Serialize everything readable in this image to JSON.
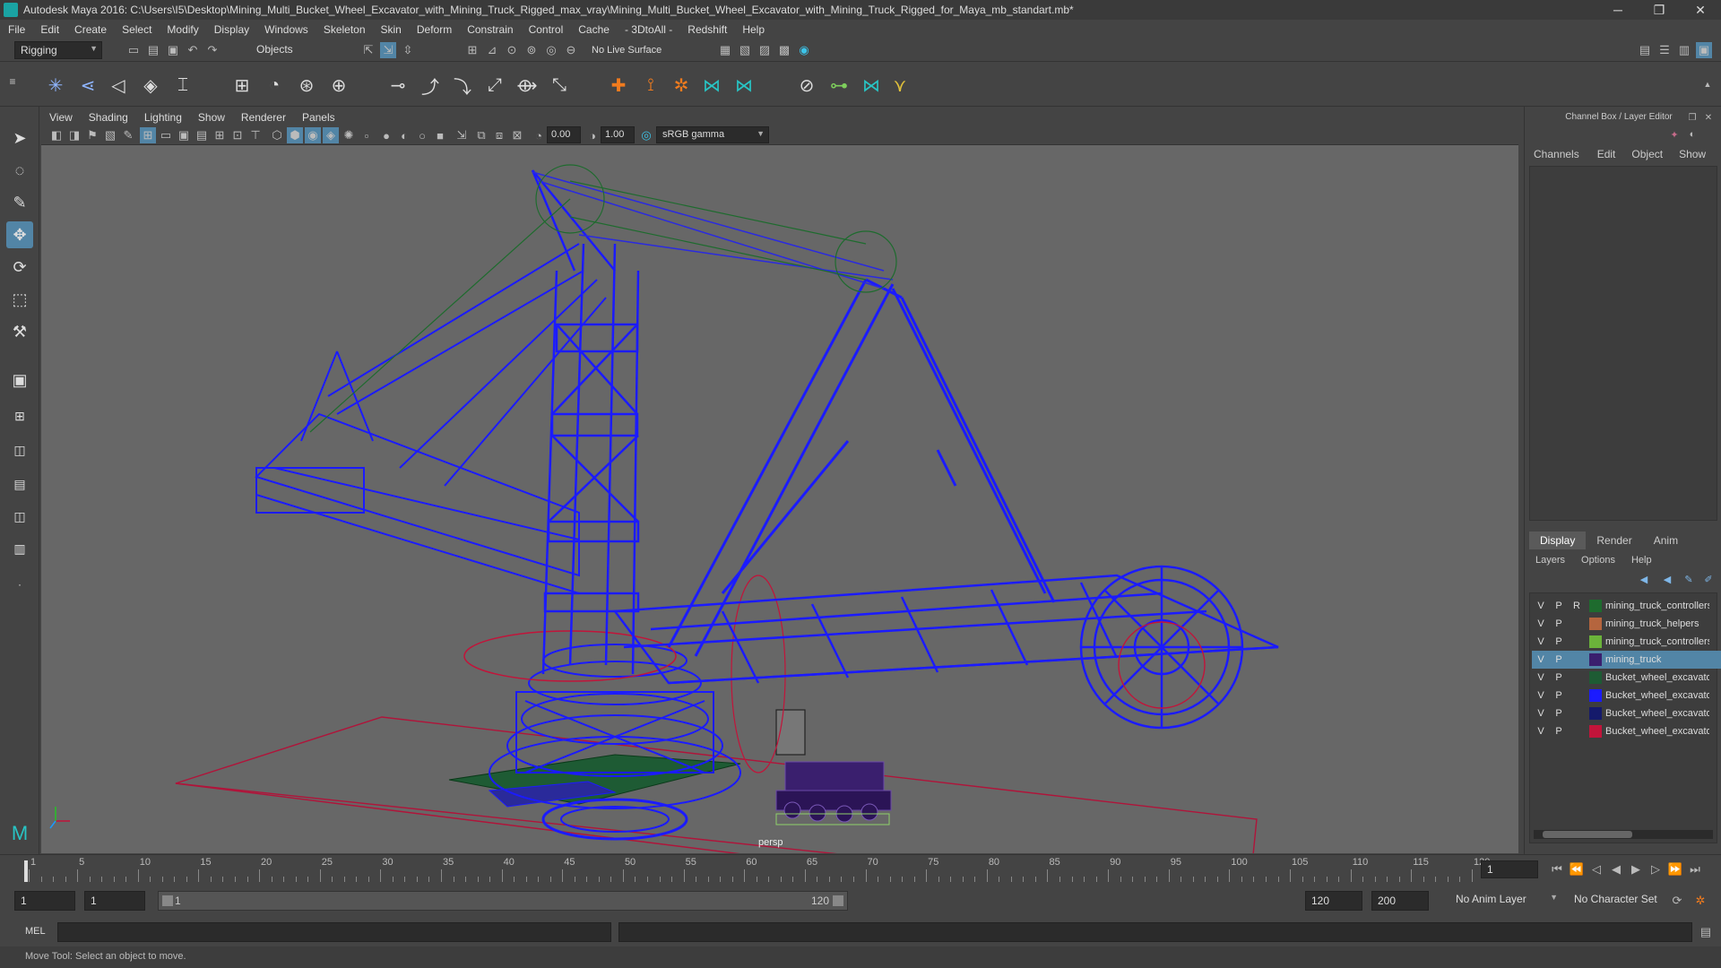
{
  "window": {
    "title": "Autodesk Maya 2016: C:\\Users\\I5\\Desktop\\Mining_Multi_Bucket_Wheel_Excavator_with_Mining_Truck_Rigged_max_vray\\Mining_Multi_Bucket_Wheel_Excavator_with_Mining_Truck_Rigged_for_Maya_mb_standart.mb*",
    "minimize": "─",
    "restore": "❐",
    "close": "✕"
  },
  "menubar": [
    "File",
    "Edit",
    "Create",
    "Select",
    "Modify",
    "Display",
    "Windows",
    "Skeleton",
    "Skin",
    "Deform",
    "Constrain",
    "Control",
    "Cache",
    "- 3DtoAll -",
    "Redshift",
    "Help"
  ],
  "statusline": {
    "menuset": "Rigging",
    "selection_mode": "Objects",
    "live_surface": "No Live Surface"
  },
  "panel_menu": [
    "View",
    "Shading",
    "Lighting",
    "Show",
    "Renderer",
    "Panels"
  ],
  "panel_tools": {
    "near_value": "0.00",
    "far_value": "1.00",
    "color_space": "sRGB gamma"
  },
  "viewport": {
    "camera_label": "persp"
  },
  "channel_box": {
    "header": "Channel Box / Layer Editor",
    "menu": [
      "Channels",
      "Edit",
      "Object",
      "Show"
    ]
  },
  "layer_editor": {
    "tabs": [
      "Display",
      "Render",
      "Anim"
    ],
    "menu": [
      "Layers",
      "Options",
      "Help"
    ],
    "layers": [
      {
        "v": "V",
        "p": "P",
        "r": "R",
        "color": "#1e6b2e",
        "name": "mining_truck_controllers",
        "selected": false
      },
      {
        "v": "V",
        "p": "P",
        "r": "",
        "color": "#b5653e",
        "name": "mining_truck_helpers",
        "selected": false
      },
      {
        "v": "V",
        "p": "P",
        "r": "",
        "color": "#6bb33a",
        "name": "mining_truck_controllers",
        "selected": false
      },
      {
        "v": "V",
        "p": "P",
        "r": "",
        "color": "#3a1f6e",
        "name": "mining_truck",
        "selected": true
      },
      {
        "v": "V",
        "p": "P",
        "r": "",
        "color": "#1e5b34",
        "name": "Bucket_wheel_excavator",
        "selected": false
      },
      {
        "v": "V",
        "p": "P",
        "r": "",
        "color": "#1b1bff",
        "name": "Bucket_wheel_excavator",
        "selected": false
      },
      {
        "v": "V",
        "p": "P",
        "r": "",
        "color": "#151a6b",
        "name": "Bucket_wheel_excavator",
        "selected": false
      },
      {
        "v": "V",
        "p": "P",
        "r": "",
        "color": "#c2143a",
        "name": "Bucket_wheel_excavator",
        "selected": false
      }
    ]
  },
  "timeline": {
    "ticks": [
      "1",
      "5",
      "10",
      "15",
      "20",
      "25",
      "30",
      "35",
      "40",
      "45",
      "50",
      "55",
      "60",
      "65",
      "70",
      "75",
      "80",
      "85",
      "90",
      "95",
      "100",
      "105",
      "110",
      "115",
      "120"
    ],
    "current_frame": "1"
  },
  "range": {
    "start": "1",
    "anim_start": "1",
    "slider_start": "1",
    "slider_end": "120",
    "end": "120",
    "anim_end": "200",
    "anim_layer": "No Anim Layer",
    "character_set": "No Character Set"
  },
  "command_line": {
    "label": "MEL"
  },
  "help_line": "Move Tool: Select an object to move."
}
